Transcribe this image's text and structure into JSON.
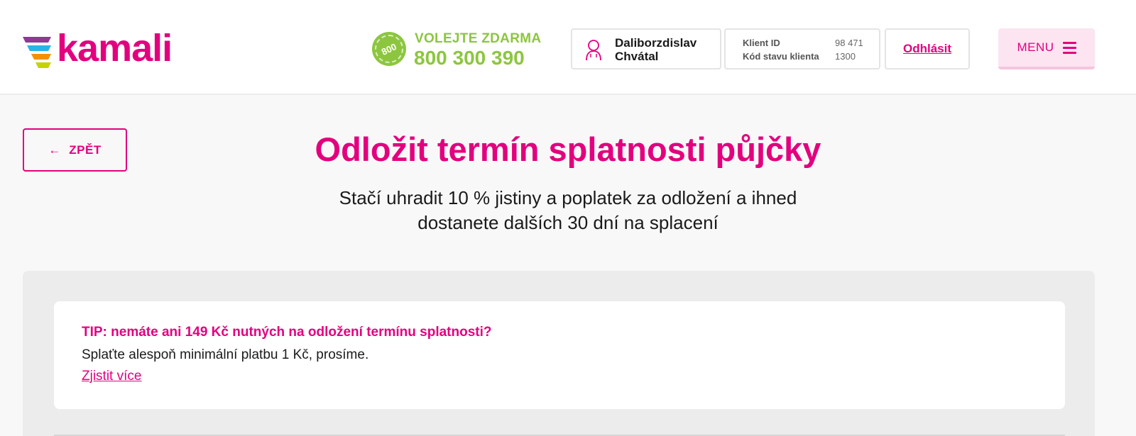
{
  "brand": {
    "logo_text": "kamali",
    "accent_color": "#e3007e",
    "green_color": "#8cc63f"
  },
  "header": {
    "phone_badge": "800",
    "call_label": "VOLEJTE ZDARMA",
    "call_number": "800 300 390",
    "user": {
      "first_name": "Daliborzdislav",
      "last_name": "Chvátal",
      "icon": "user-icon"
    },
    "client": {
      "id_label": "Klient ID",
      "id_value": "98 471",
      "status_label": "Kód stavu klienta",
      "status_value": "1300"
    },
    "logout_label": "Odhlásit",
    "menu_label": "MENU",
    "menu_icon": "hamburger-icon"
  },
  "main": {
    "back_label": "ZPĚT",
    "back_icon": "arrow-left-icon",
    "title": "Odložit termín splatnosti půjčky",
    "subtitle_line1": "Stačí uhradit 10 % jistiny a poplatek za odložení a ihned",
    "subtitle_line2": "dostanete dalších 30 dní na splacení"
  },
  "tip": {
    "title": "TIP: nemáte ani 149 Kč nutných na odložení termínu splatnosti?",
    "text": "Splaťte alespoň minimální platbu 1 Kč, prosíme.",
    "link": "Zjistit více"
  }
}
